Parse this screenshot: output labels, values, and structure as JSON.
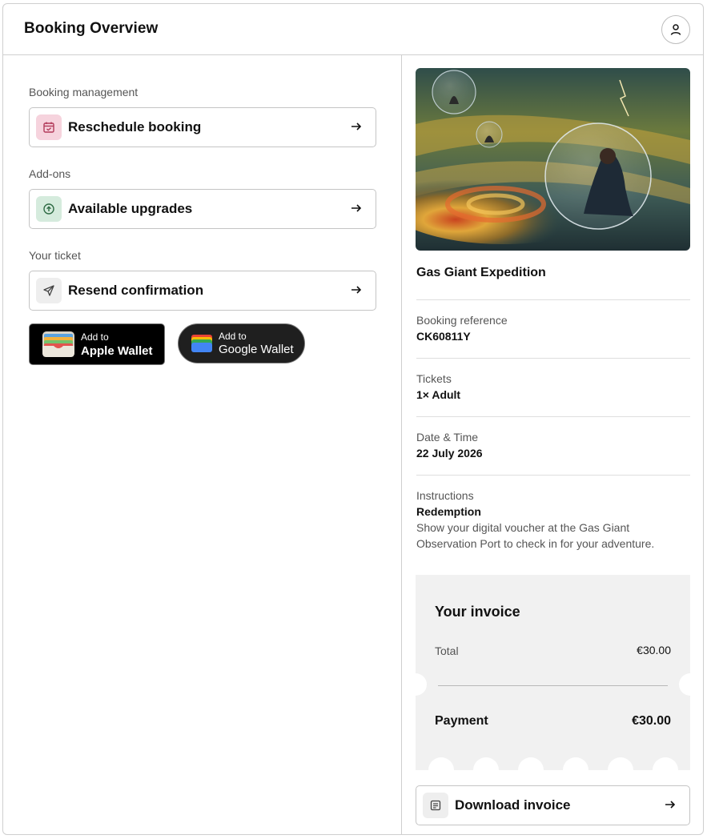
{
  "header": {
    "title": "Booking Overview",
    "profile_icon": "user-icon"
  },
  "left": {
    "sections": [
      {
        "label": "Booking management",
        "action": {
          "label": "Reschedule booking",
          "icon": "calendar-check-icon",
          "icon_bg": "#f6d3dd",
          "icon_color": "#b23a5a"
        }
      },
      {
        "label": "Add-ons",
        "action": {
          "label": "Available upgrades",
          "icon": "arrow-up-circle-icon",
          "icon_bg": "#d5ebdd",
          "icon_color": "#2f6b45"
        }
      },
      {
        "label": "Your ticket",
        "action": {
          "label": "Resend confirmation",
          "icon": "send-icon",
          "icon_bg": "#eeeeee",
          "icon_color": "#444444"
        }
      }
    ],
    "wallets": {
      "apple": {
        "small": "Add to",
        "big": "Apple Wallet"
      },
      "google": {
        "small": "Add to",
        "big": "Google Wallet"
      }
    }
  },
  "right": {
    "experience_title": "Gas Giant Expedition",
    "details": [
      {
        "label": "Booking reference",
        "value": "CK60811Y"
      },
      {
        "label": "Tickets",
        "value": "1× Adult"
      },
      {
        "label": "Date & Time",
        "value": "22 July 2026"
      },
      {
        "label": "Instructions",
        "value": "Redemption",
        "text": "Show your digital voucher at the Gas Giant Observation Port to check in for your adventure."
      }
    ],
    "invoice": {
      "title": "Your invoice",
      "total_label": "Total",
      "total_value": "€30.00",
      "payment_label": "Payment",
      "payment_value": "€30.00"
    },
    "download": {
      "label": "Download invoice",
      "icon": "receipt-icon"
    }
  }
}
